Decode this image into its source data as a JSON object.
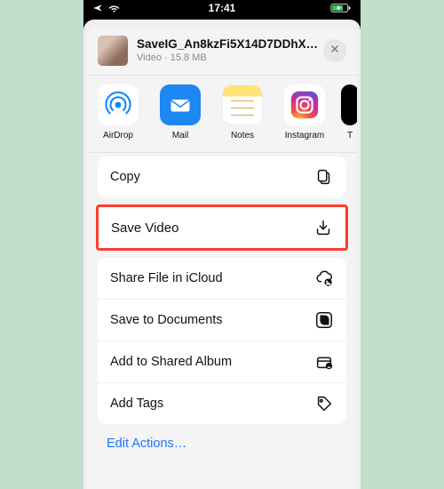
{
  "status_bar": {
    "time": "17:41"
  },
  "header": {
    "filename": "SaveIG_An8kzFi5X14D7DDhXM...",
    "subtitle": "Video · 15.8 MB"
  },
  "share_apps": {
    "airdrop": "AirDrop",
    "mail": "Mail",
    "notes": "Notes",
    "instagram": "Instagram",
    "peek": "T"
  },
  "actions": {
    "copy": "Copy",
    "save_video": "Save Video",
    "share_icloud": "Share File in iCloud",
    "save_docs": "Save to Documents",
    "add_shared_album": "Add to Shared Album",
    "add_tags": "Add Tags"
  },
  "edit": "Edit Actions…"
}
